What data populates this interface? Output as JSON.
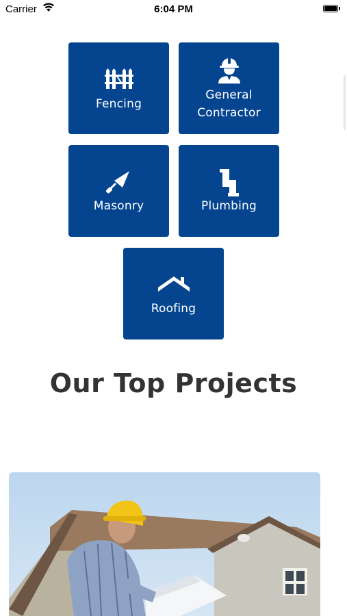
{
  "status_bar": {
    "carrier": "Carrier",
    "time": "6:04 PM"
  },
  "services": [
    {
      "label": "Fencing",
      "icon": "fence-icon"
    },
    {
      "label": "General Contractor",
      "label_line1": "General",
      "label_line2": "Contractor",
      "icon": "worker-hardhat-icon"
    },
    {
      "label": "Masonry",
      "icon": "trowel-icon"
    },
    {
      "label": "Plumbing",
      "icon": "pipe-icon"
    },
    {
      "label": "Roofing",
      "icon": "roof-icon"
    }
  ],
  "projects": {
    "title": "Our Top Projects",
    "image_icon": "contractor-on-roof-photo"
  },
  "colors": {
    "tile": "#05458f",
    "title": "#333333",
    "background": "#ffffff"
  }
}
